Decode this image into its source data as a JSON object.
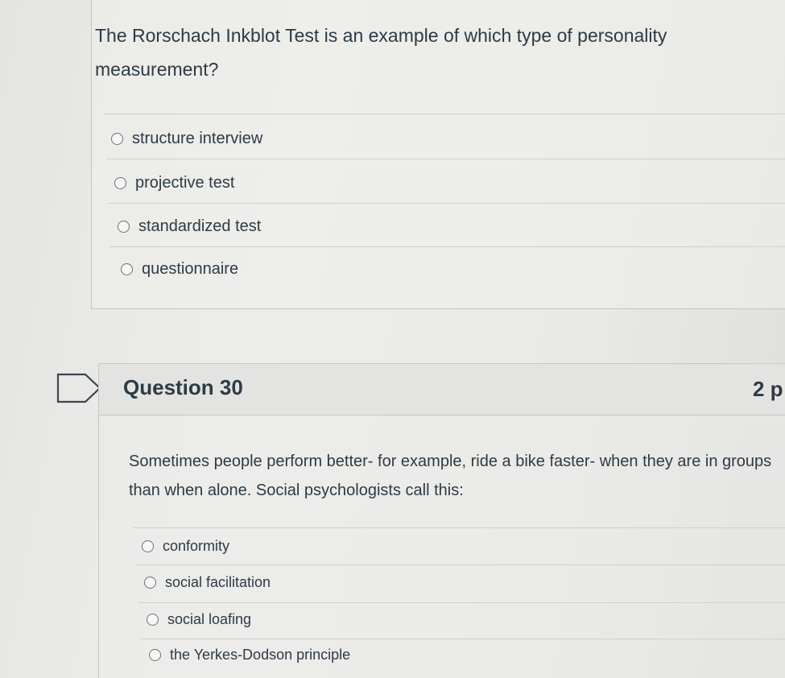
{
  "question29": {
    "text": "The Rorschach Inkblot Test is an example of which type of personality measurement?",
    "answers": [
      {
        "label": "structure interview",
        "selected": false
      },
      {
        "label": "projective test",
        "selected": false
      },
      {
        "label": "standardized test",
        "selected": false
      },
      {
        "label": "questionnaire",
        "selected": false
      }
    ]
  },
  "question30": {
    "title": "Question 30",
    "points": "2 p",
    "text": "Sometimes people perform better- for example, ride a bike faster- when they are in groups than when alone. Social psychologists call this:",
    "answers": [
      {
        "label": "conformity",
        "selected": false
      },
      {
        "label": "social facilitation",
        "selected": false
      },
      {
        "label": "social loafing",
        "selected": false
      },
      {
        "label": "the Yerkes-Dodson principle",
        "selected": false
      }
    ]
  },
  "icons": {
    "flag": "flag-question-icon",
    "radio": "radio-button-icon"
  },
  "colors": {
    "text": "#2d3b45",
    "background": "#e9e9e6",
    "border": "#c6c8c6"
  }
}
